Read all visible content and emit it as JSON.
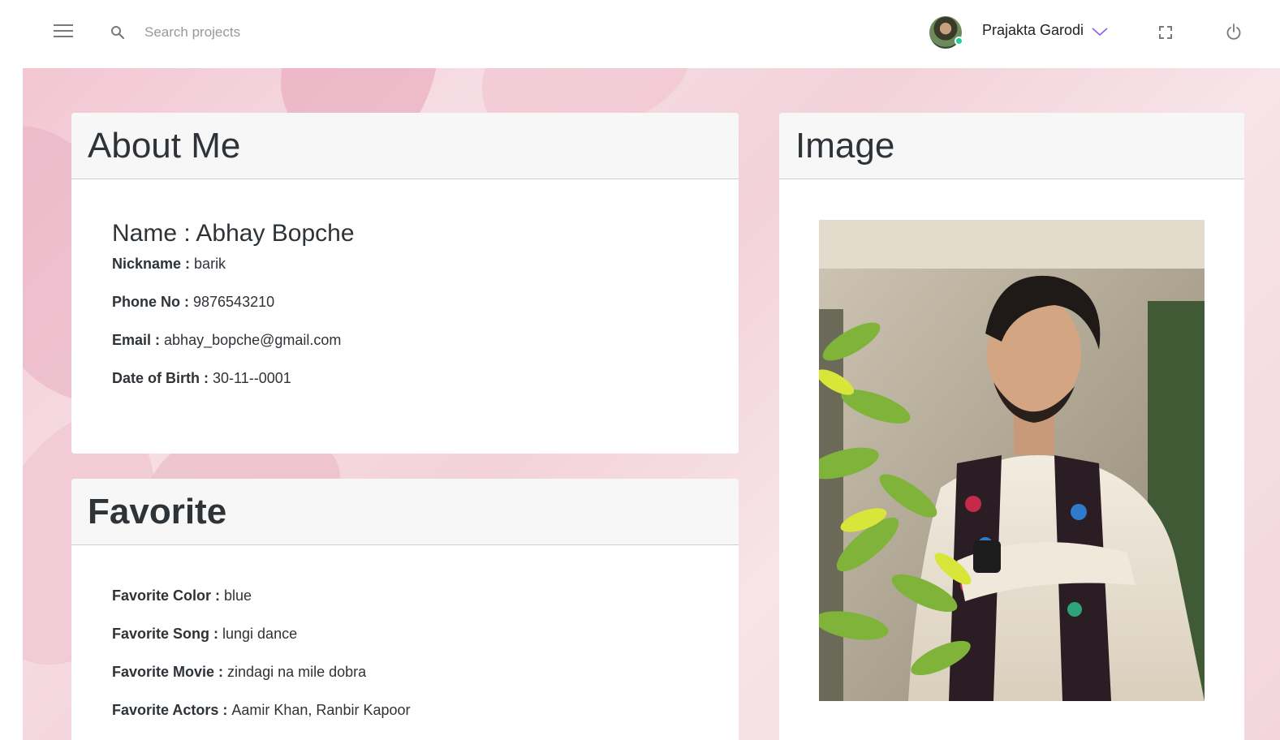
{
  "topbar": {
    "search_placeholder": "Search projects",
    "user_name": "Prajakta Garodi",
    "online_status_color": "#1ccfa0",
    "accent_color": "#8a5cf6"
  },
  "about": {
    "title": "About Me",
    "name_label": "Name : ",
    "name_value": "Abhay Bopche",
    "fields": [
      {
        "label": "Nickname : ",
        "value": "barik"
      },
      {
        "label": "Phone No : ",
        "value": "9876543210"
      },
      {
        "label": "Email : ",
        "value": "abhay_bopche@gmail.com"
      },
      {
        "label": "Date of Birth : ",
        "value": "30-11--0001"
      }
    ]
  },
  "favorite": {
    "title": "Favorite",
    "fields": [
      {
        "label": "Favorite Color : ",
        "value": "blue"
      },
      {
        "label": "Favorite Song : ",
        "value": "lungi dance"
      },
      {
        "label": "Favorite Movie : ",
        "value": "zindagi na mile dobra"
      },
      {
        "label": "Favorite Actors : ",
        "value": "Aamir Khan, Ranbir Kapoor"
      }
    ]
  },
  "image_card": {
    "title": "Image"
  },
  "icons": {
    "menu": "menu-icon",
    "search": "search-icon",
    "chevron": "chevron-down-icon",
    "fullscreen": "fullscreen-icon",
    "power": "power-icon"
  }
}
